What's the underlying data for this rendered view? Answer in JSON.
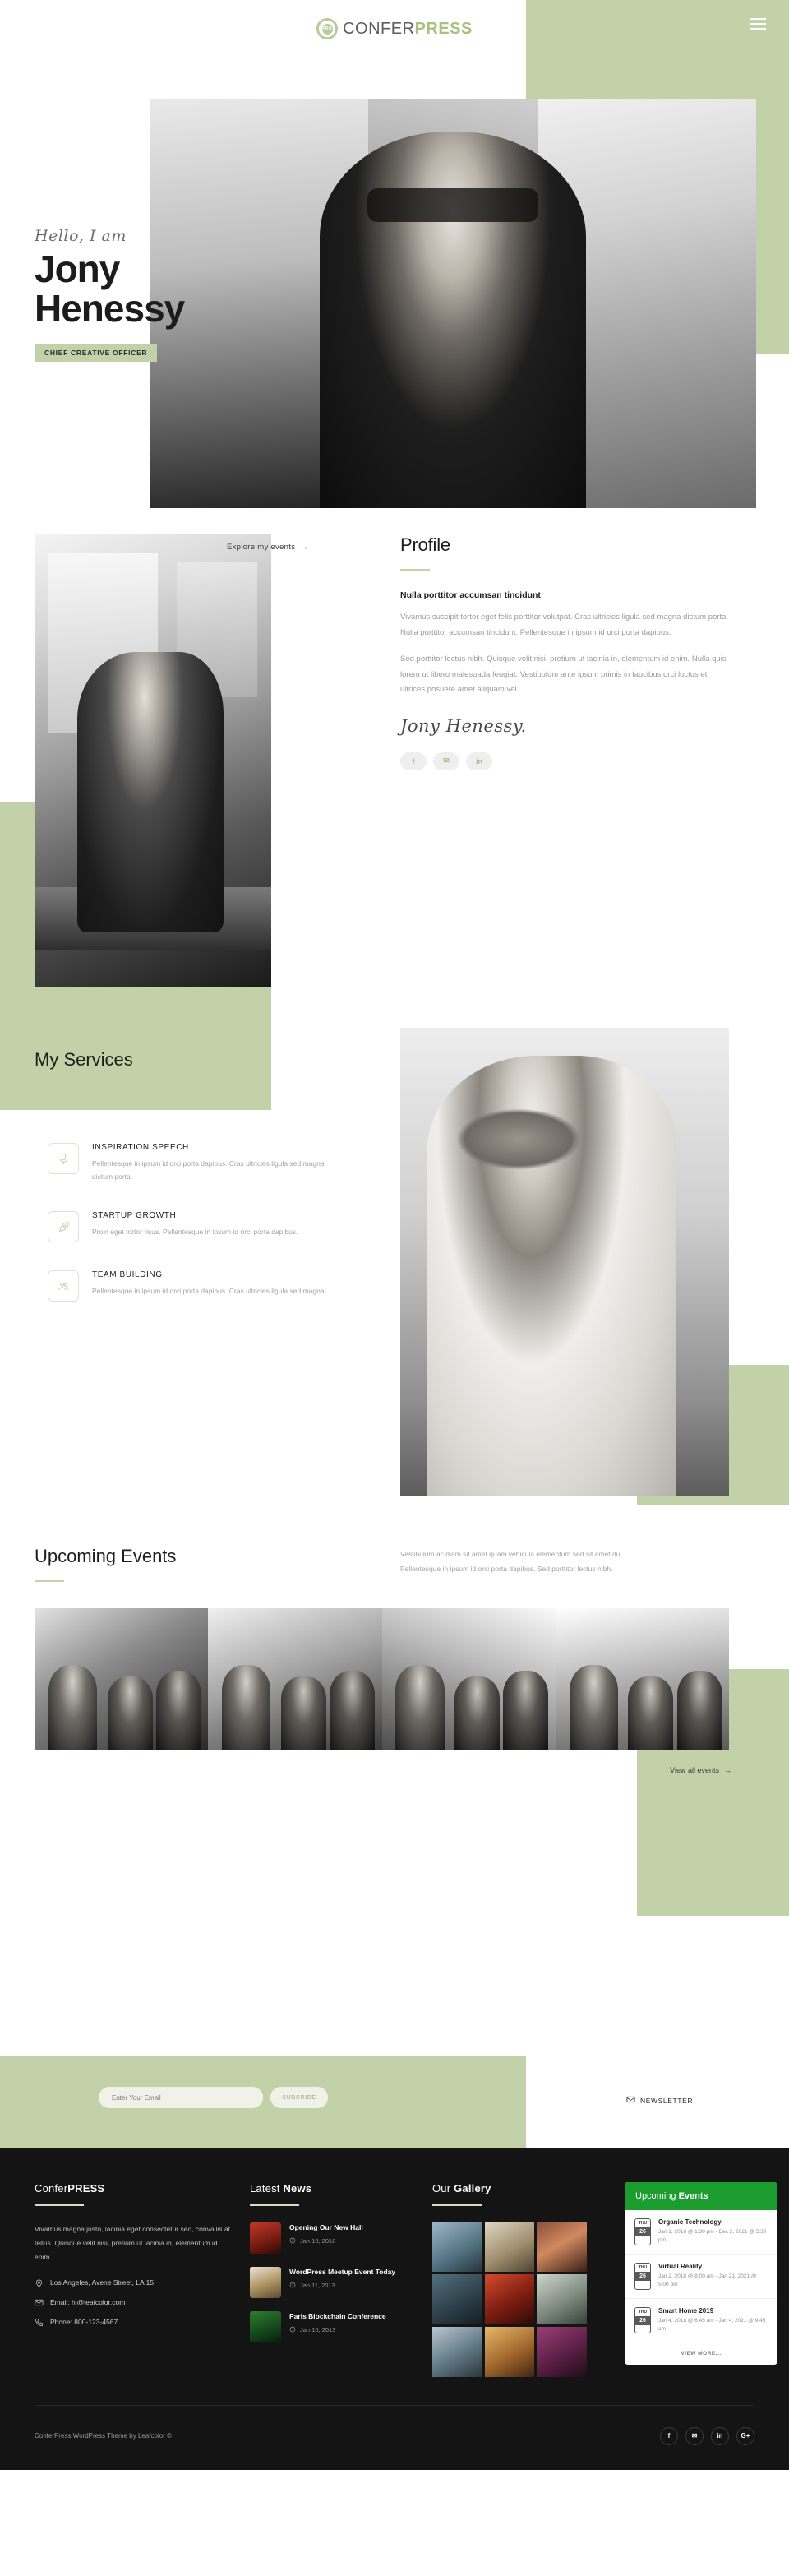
{
  "header": {
    "logo_main": "CONFER",
    "logo_accent": "PRESS",
    "logo_mark_text": "PRO",
    "menu_icon": "hamburger-menu-icon"
  },
  "hero": {
    "greeting": "Hello, I am",
    "first_name": "Jony",
    "last_name": "Henessy",
    "badge": "CHIEF CREATIVE OFFICER",
    "cta_label": "Explore my events",
    "cta_arrow": "→"
  },
  "profile": {
    "title": "Profile",
    "subtitle": "Nulla porttitor accumsan tincidunt",
    "paragraph1": "Vivamus suscipit tortor eget felis porttitor volutpat. Cras ultricies ligula sed magna dictum porta. Nulla porttitor accumsan tincidunt. Pellentesque in ipsum id orci porta dapibus.",
    "paragraph2": "Sed porttitor lectus nibh. Quisque velit nisi, pretium ut lacinia in, elementum id enim. Nulla quis lorem ut libero malesuada feugiat. Vestibulum ante ipsum primis in faucibus orci luctus et ultrices posuere amet aliquam vel.",
    "signature": "Jony Henessy.",
    "socials": [
      {
        "name": "facebook",
        "glyph": "f"
      },
      {
        "name": "twitter",
        "glyph": "✉"
      },
      {
        "name": "linkedin",
        "glyph": "in"
      }
    ]
  },
  "services": {
    "title": "My Services",
    "items": [
      {
        "icon": "microphone-icon",
        "title": "INSPIRATION SPEECH",
        "text": "Pellentesque in ipsum id orci porta dapibus. Cras ultricies ligula sed magna dictum porta."
      },
      {
        "icon": "rocket-icon",
        "title": "STARTUP GROWTH",
        "text": "Proin eget tortor risus. Pellentesque in ipsum id orci porta dapibus."
      },
      {
        "icon": "team-icon",
        "title": "TEAM BUILDING",
        "text": "Pellentesque in ipsum id orci porta dapibus. Cras ultricies ligula sed magna."
      }
    ]
  },
  "upcoming": {
    "title": "Upcoming Events",
    "description_line1": "Vestibulum ac diam sit amet quam vehicula elementum sed sit amet dui.",
    "description_line2": "Pellentesque in ipsum id orci porta dapibus. Sed porttitor lectus nibh.",
    "cta_label": "View all events",
    "cta_arrow": "→"
  },
  "newsletter": {
    "input_placeholder": "Enter Your Email",
    "input_value": "",
    "button_label": "SUBCRIBE",
    "label": "NEWSLETTER",
    "icon": "envelope-icon"
  },
  "footer": {
    "about": {
      "brand_light": "Confer",
      "brand_bold": "PRESS",
      "text": "Vivamus magna justo, lacinia eget consectetur sed, convallis at tellus. Quisque velit nisi, pretium ut lacinia in, elementum id enim.",
      "address": "Los Angeles, Avene Street, LA 15",
      "email": "Email: hi@leafcolor.com",
      "phone": "Phone: 800-123-4567"
    },
    "news": {
      "heading_light": "Latest ",
      "heading_bold": "News",
      "items": [
        {
          "title": "Opening Our New Hall",
          "date": "Jan 10, 2018"
        },
        {
          "title": "WordPress Meetup Event Today",
          "date": "Jan 11, 2013"
        },
        {
          "title": "Paris Blockchain Conference",
          "date": "Jan 10, 2013"
        }
      ]
    },
    "gallery": {
      "heading_light": "Our ",
      "heading_bold": "Gallery",
      "cell_count": 9
    },
    "upcoming_widget": {
      "heading_light": "Upcoming ",
      "heading_bold": "Events",
      "items": [
        {
          "day": "THU",
          "date_num": "26",
          "title": "Organic Technology",
          "detail": "Jan 1, 2018 @ 1:30 pm - Dec 2, 2021 @ 5:30 pm"
        },
        {
          "day": "THU",
          "date_num": "26",
          "title": "Virtual Reality",
          "detail": "Jan 2, 2018 @ 8:00 am - Jan 21, 2021 @ 5:00 pm"
        },
        {
          "day": "THU",
          "date_num": "26",
          "title": "Smart Home 2019",
          "detail": "Jan 4, 2018 @ 6:45 am - Jan 4, 2021 @ 9:45 am"
        }
      ],
      "view_more": "VIEW MORE..."
    },
    "copyright": "ConferPress WordPress Theme by Leafcolor ©",
    "socials": [
      {
        "name": "facebook",
        "glyph": "f"
      },
      {
        "name": "twitter",
        "glyph": "✉"
      },
      {
        "name": "linkedin",
        "glyph": "in"
      },
      {
        "name": "google-plus",
        "glyph": "G+"
      }
    ]
  },
  "colors": {
    "green_panel": "#c3d1a8",
    "green_accent": "#a9c07f",
    "footer_bg": "#141414",
    "widget_green": "#1a9c2e"
  }
}
